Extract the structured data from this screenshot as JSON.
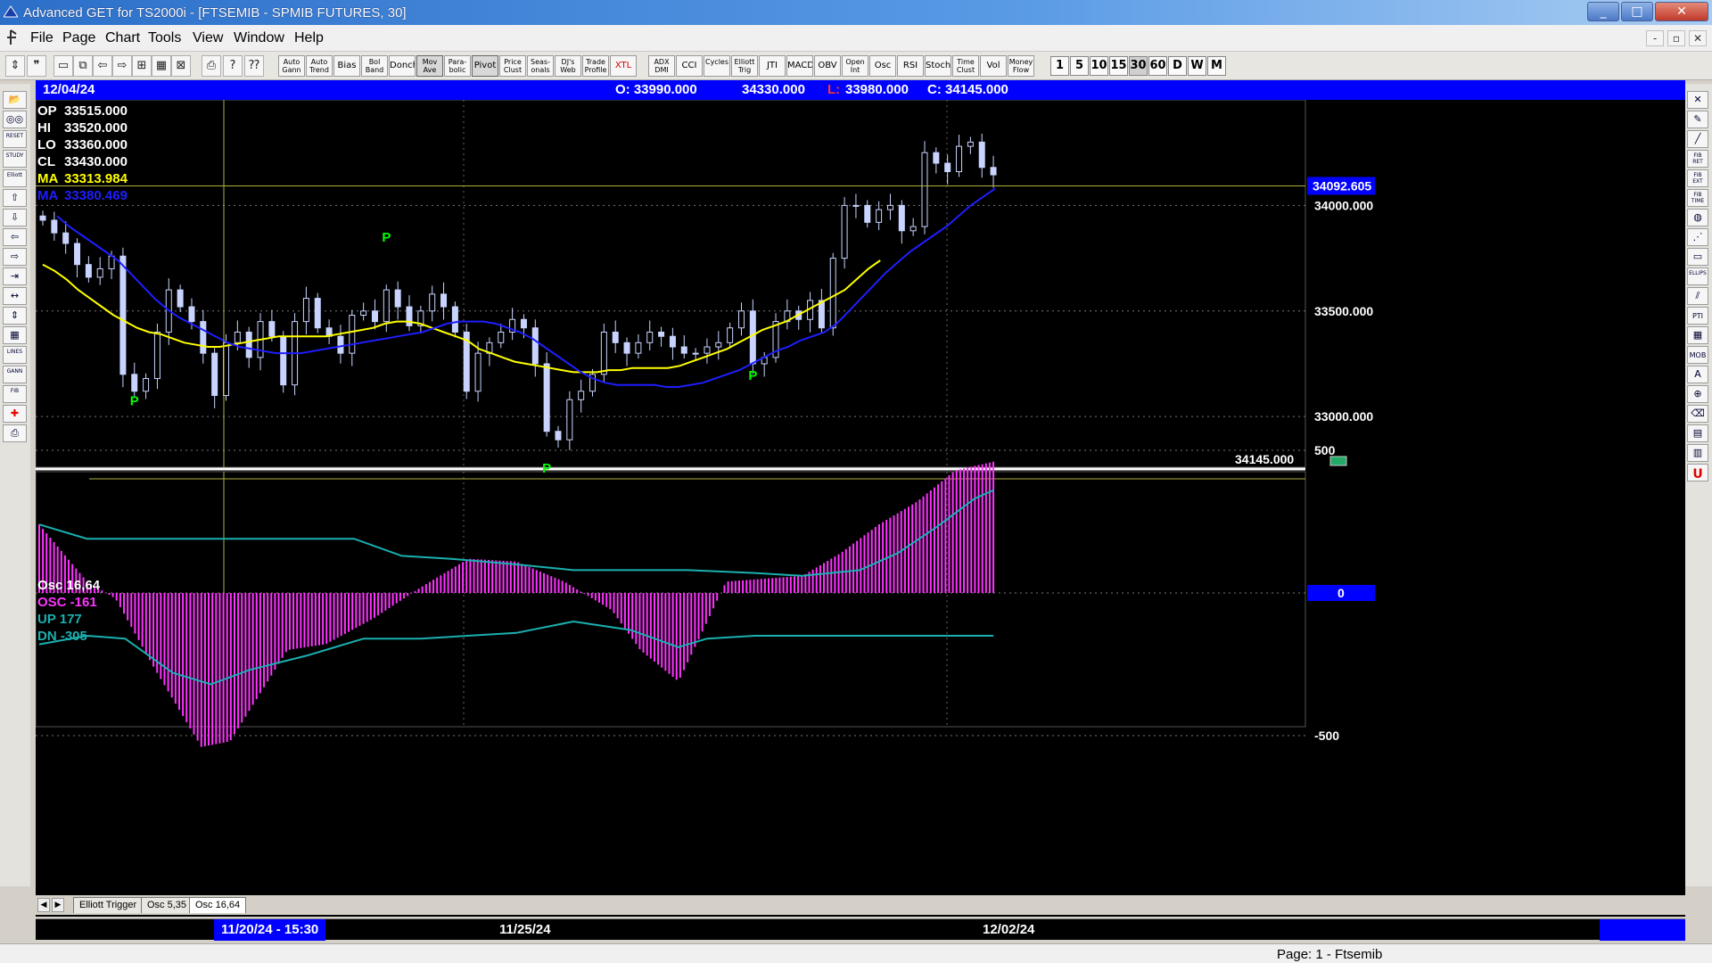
{
  "window": {
    "title": "Advanced GET for TS2000i - [FTSEMIB - SPMIB FUTURES, 30]",
    "minimize": "_",
    "maximize": "□",
    "close": "✕"
  },
  "menu": {
    "items": [
      "File",
      "Page",
      "Chart",
      "Tools",
      "View",
      "Window",
      "Help"
    ],
    "mdi": [
      "-",
      "▫",
      "✕"
    ]
  },
  "toolbar": {
    "icons": [
      "pointer-icon",
      "quote-icon",
      "page-icon",
      "copy-icon",
      "back-icon",
      "forward-icon",
      "tile-icon",
      "grid-icon",
      "cancel-icon",
      "print-icon",
      "help-icon",
      "whatsthis-icon"
    ],
    "studies": [
      "Auto Gann",
      "Auto Trend",
      "Bias",
      "Bol Band",
      "Donch",
      "Mov Ave",
      "Para-bolic",
      "Pivot",
      "Price Clust",
      "Seas-onals",
      "DJ's Web",
      "Trade Profile",
      "XTL",
      "ADX DMI",
      "CCI",
      "Cycles",
      "Elliott Trig",
      "JTI",
      "MACD",
      "OBV",
      "Open Int",
      "Osc",
      "RSI",
      "Stoch",
      "Time Clust",
      "Vol",
      "Money Flow"
    ],
    "timeframes": [
      "1",
      "5",
      "10",
      "15",
      "30",
      "60",
      "D",
      "W",
      "M"
    ],
    "active_timeframe": "30"
  },
  "left_tools": [
    "open-icon",
    "binoculars-icon",
    "RESET",
    "STUDY",
    "Elliott",
    "up-arrow-icon",
    "down-arrow-icon",
    "left-arrow-icon",
    "right-arrow-icon",
    "compress-icon",
    "expand-icon",
    "zoom-icon",
    "grid-icon",
    "LINES",
    "GANN",
    "FIB",
    "crosshair-icon",
    "print-icon"
  ],
  "right_tools": [
    "close-icon",
    "pencil-icon",
    "line-icon",
    "FIB RET",
    "FIB EXT",
    "FIB TIME",
    "cycle-icon",
    "fan-icon",
    "box-icon",
    "ELLIPS",
    "channel-icon",
    "PTI",
    "grid-icon",
    "MOB",
    "text-icon",
    "magnify-icon",
    "eraser-icon",
    "grid2-icon",
    "layers-icon",
    "U"
  ],
  "header": {
    "date": "12/04/24",
    "open": "O: 33990.000",
    "high": "34330.000",
    "low_label": "L:",
    "low": "33980.000",
    "close": "C: 34145.000"
  },
  "price_panel": {
    "readouts": [
      {
        "label": "OP",
        "value": "33515.000",
        "color": "#ffffff"
      },
      {
        "label": "HI",
        "value": "33520.000",
        "color": "#ffffff"
      },
      {
        "label": "LO",
        "value": "33360.000",
        "color": "#ffffff"
      },
      {
        "label": "CL",
        "value": "33430.000",
        "color": "#ffffff"
      },
      {
        "label": "MA",
        "value": "33313.984",
        "color": "#ffff00"
      },
      {
        "label": "MA",
        "value": "33380.469",
        "color": "#1e1eff"
      }
    ],
    "cursor_price": "34092.605",
    "last_price": "34145.000",
    "pivot_label": "P",
    "axis_ticks": [
      "34000.000",
      "33500.000",
      "33000.000"
    ]
  },
  "osc_panel": {
    "readouts": [
      {
        "label": "Osc 16,64",
        "color": "#ffffff"
      },
      {
        "label": "OSC -161",
        "color": "#ff33ff"
      },
      {
        "label": "UP    177",
        "color": "#1ab0b0"
      },
      {
        "label": "DN   -305",
        "color": "#1ab0b0"
      }
    ],
    "axis_ticks": [
      "500",
      "0",
      "-500"
    ]
  },
  "tabs": {
    "items": [
      "Elliott Trigger",
      "Osc 5,35",
      "Osc 16,64"
    ],
    "active": "Osc 16,64",
    "prev": "◀",
    "next": "▶"
  },
  "dates": {
    "cursor": "11/20/24 - 15:30",
    "labels": [
      "11/25/24",
      "12/02/24"
    ]
  },
  "status": {
    "page": "Page: 1 - Ftsemib"
  },
  "chart_data": {
    "type": "candlestick",
    "symbol": "FTSEMIB - SPMIB FUTURES",
    "interval": "30",
    "ylim": [
      32760,
      34500
    ],
    "yticks": [
      33000,
      33500,
      34000
    ],
    "date_labels": [
      "11/25/24",
      "12/02/24"
    ],
    "cursor_price": 34092.605,
    "last_price": 34145,
    "pivots": [
      {
        "bar": 8,
        "price": 33130,
        "type": "low"
      },
      {
        "bar": 30,
        "price": 33760,
        "type": "high"
      },
      {
        "bar": 44,
        "price": 32810,
        "type": "low"
      },
      {
        "bar": 62,
        "price": 33250,
        "type": "low"
      }
    ],
    "closes": [
      33930,
      33870,
      33820,
      33720,
      33660,
      33700,
      33760,
      33200,
      33120,
      33180,
      33400,
      33600,
      33520,
      33450,
      33300,
      33100,
      33350,
      33400,
      33280,
      33450,
      33380,
      33150,
      33450,
      33560,
      33420,
      33380,
      33300,
      33480,
      33500,
      33450,
      33600,
      33520,
      33430,
      33500,
      33580,
      33520,
      33400,
      33120,
      33300,
      33350,
      33400,
      33460,
      33420,
      33250,
      32930,
      32890,
      33080,
      33120,
      33200,
      33400,
      33350,
      33300,
      33350,
      33400,
      33380,
      33330,
      33300,
      33300,
      33330,
      33350,
      33420,
      33500,
      33250,
      33280,
      33450,
      33500,
      33460,
      33550,
      33420,
      33750,
      34000,
      34000,
      33920,
      33980,
      34000,
      33880,
      33900,
      34250,
      34200,
      34160,
      34280,
      34300,
      34180,
      34145
    ],
    "ma_fast": [
      33720,
      33690,
      33650,
      33600,
      33560,
      33520,
      33480,
      33450,
      33420,
      33400,
      33390,
      33370,
      33350,
      33340,
      33330,
      33330,
      33340,
      33350,
      33360,
      33370,
      33380,
      33380,
      33380,
      33380,
      33380,
      33390,
      33400,
      33410,
      33420,
      33440,
      33450,
      33450,
      33440,
      33420,
      33400,
      33380,
      33360,
      33320,
      33300,
      33280,
      33260,
      33250,
      33240,
      33230,
      33220,
      33210,
      33210,
      33210,
      33220,
      33220,
      33230,
      33230,
      33230,
      33230,
      33240,
      33260,
      33280,
      33300,
      33320,
      33350,
      33380,
      33410,
      33430,
      33450,
      33480,
      33510,
      33540,
      33570,
      33600,
      33650,
      33700,
      33740
    ],
    "ma_slow": [
      33950,
      33900,
      33860,
      33820,
      33780,
      33740,
      33680,
      33620,
      33560,
      33510,
      33470,
      33440,
      33410,
      33380,
      33350,
      33330,
      33320,
      33310,
      33300,
      33300,
      33300,
      33310,
      33320,
      33330,
      33340,
      33350,
      33360,
      33370,
      33380,
      33390,
      33400,
      33420,
      33440,
      33450,
      33450,
      33450,
      33440,
      33420,
      33400,
      33370,
      33330,
      33290,
      33250,
      33210,
      33180,
      33160,
      33150,
      33150,
      33150,
      33150,
      33140,
      33140,
      33150,
      33160,
      33180,
      33200,
      33220,
      33250,
      33280,
      33310,
      33330,
      33360,
      33380,
      33400,
      33440,
      33500,
      33560,
      33620,
      33680,
      33730,
      33780,
      33820,
      33860,
      33900,
      33950,
      34000,
      34040,
      34080
    ]
  }
}
